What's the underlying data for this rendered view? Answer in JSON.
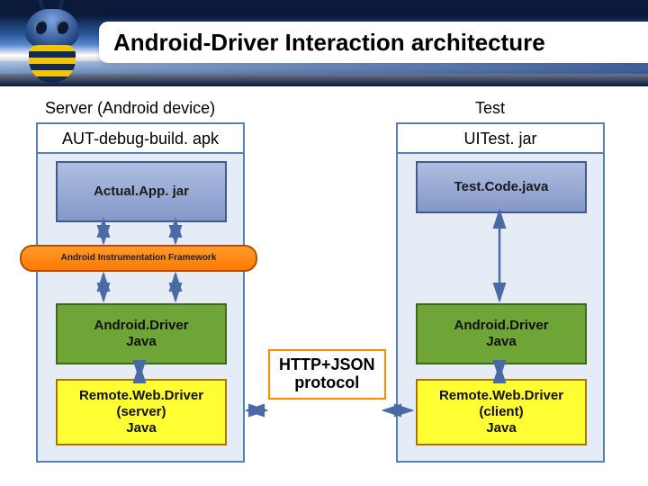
{
  "title": "Android-Driver Interaction architecture",
  "left": {
    "label": "Server (Android device)",
    "container_title": "AUT-debug-build. apk",
    "actual_app": "Actual.App. jar",
    "framework": "Android Instrumentation Framework",
    "driver": "Android.Driver\nJava",
    "remote": "Remote.Web.Driver\n(server)\nJava"
  },
  "right": {
    "label": "Test",
    "container_title": "UITest. jar",
    "test_code": "Test.Code.java",
    "driver": "Android.Driver\nJava",
    "remote": "Remote.Web.Driver\n(client)\nJava"
  },
  "protocol": "HTTP+JSON\nprotocol"
}
